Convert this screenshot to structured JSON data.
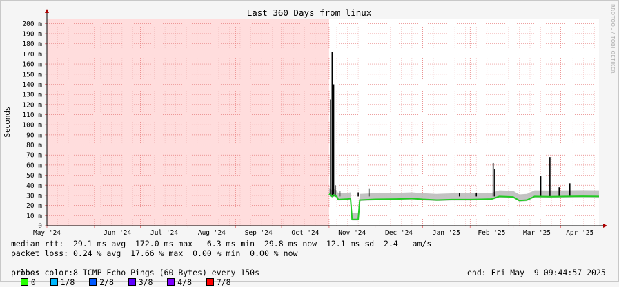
{
  "chart_data": {
    "type": "area",
    "title": "Last 360 Days from linux",
    "ylabel": "Seconds",
    "xlabel": "",
    "x_axis_type": "date",
    "x_range": [
      "2024-05-01",
      "2025-04-26"
    ],
    "ylim": [
      0,
      0.205
    ],
    "grid": true,
    "y_ticks": [
      {
        "value": 0,
        "label": "0"
      },
      {
        "value": 0.01,
        "label": "10 m"
      },
      {
        "value": 0.02,
        "label": "20 m"
      },
      {
        "value": 0.03,
        "label": "30 m"
      },
      {
        "value": 0.04,
        "label": "40 m"
      },
      {
        "value": 0.05,
        "label": "50 m"
      },
      {
        "value": 0.06,
        "label": "60 m"
      },
      {
        "value": 0.07,
        "label": "70 m"
      },
      {
        "value": 0.08,
        "label": "80 m"
      },
      {
        "value": 0.09,
        "label": "90 m"
      },
      {
        "value": 0.1,
        "label": "100 m"
      },
      {
        "value": 0.11,
        "label": "110 m"
      },
      {
        "value": 0.12,
        "label": "120 m"
      },
      {
        "value": 0.13,
        "label": "130 m"
      },
      {
        "value": 0.14,
        "label": "140 m"
      },
      {
        "value": 0.15,
        "label": "150 m"
      },
      {
        "value": 0.16,
        "label": "160 m"
      },
      {
        "value": 0.17,
        "label": "170 m"
      },
      {
        "value": 0.18,
        "label": "180 m"
      },
      {
        "value": 0.19,
        "label": "190 m"
      },
      {
        "value": 0.2,
        "label": "200 m"
      }
    ],
    "x_ticks": [
      {
        "date": "2024-05-01",
        "label": "May '24"
      },
      {
        "date": "2024-06-01",
        "label": "Jun '24"
      },
      {
        "date": "2024-07-01",
        "label": "Jul '24"
      },
      {
        "date": "2024-08-01",
        "label": "Aug '24"
      },
      {
        "date": "2024-09-01",
        "label": "Sep '24"
      },
      {
        "date": "2024-10-01",
        "label": "Oct '24"
      },
      {
        "date": "2024-11-01",
        "label": "Nov '24"
      },
      {
        "date": "2024-12-01",
        "label": "Dec '24"
      },
      {
        "date": "2025-01-01",
        "label": "Jan '25"
      },
      {
        "date": "2025-02-01",
        "label": "Feb '25"
      },
      {
        "date": "2025-03-01",
        "label": "Mar '25"
      },
      {
        "date": "2025-04-01",
        "label": "Apr '25"
      }
    ],
    "unknown_region": {
      "from": "2024-05-01",
      "to": "2024-11-01",
      "color": "#ffdddd"
    },
    "colors": {
      "background": "#f5f5f5",
      "plot_background": "#ffffff",
      "grid": "#e88080",
      "smoke": "#bdbdbd",
      "median_line": "#22cc22",
      "max_spike": "#000000",
      "axis": "#000000",
      "arrow": "#aa0000"
    },
    "series": [
      {
        "name": "median rtt",
        "points": [
          [
            "2024-11-01",
            0.0315
          ],
          [
            "2024-11-02",
            0.03
          ],
          [
            "2024-11-03",
            0.029
          ],
          [
            "2024-11-04",
            0.0305
          ],
          [
            "2024-11-05",
            0.0295
          ],
          [
            "2024-11-06",
            0.029
          ],
          [
            "2024-11-07",
            0.026
          ],
          [
            "2024-11-10",
            0.0262
          ],
          [
            "2024-11-13",
            0.0265
          ],
          [
            "2024-11-15",
            0.027
          ],
          [
            "2024-11-16",
            0.0063
          ],
          [
            "2024-11-20",
            0.0063
          ],
          [
            "2024-11-21",
            0.0255
          ],
          [
            "2024-12-01",
            0.0262
          ],
          [
            "2024-12-15",
            0.0265
          ],
          [
            "2024-12-25",
            0.027
          ],
          [
            "2025-01-01",
            0.0262
          ],
          [
            "2025-01-10",
            0.0255
          ],
          [
            "2025-01-20",
            0.026
          ],
          [
            "2025-02-01",
            0.026
          ],
          [
            "2025-02-15",
            0.0265
          ],
          [
            "2025-02-20",
            0.029
          ],
          [
            "2025-03-01",
            0.0285
          ],
          [
            "2025-03-05",
            0.025
          ],
          [
            "2025-03-10",
            0.0255
          ],
          [
            "2025-03-15",
            0.029
          ],
          [
            "2025-03-25",
            0.0288
          ],
          [
            "2025-04-05",
            0.029
          ],
          [
            "2025-04-15",
            0.0292
          ],
          [
            "2025-04-26",
            0.029
          ]
        ]
      },
      {
        "name": "max",
        "spikes": [
          [
            "2024-11-02",
            0.125
          ],
          [
            "2024-11-03",
            0.172
          ],
          [
            "2024-11-04",
            0.14
          ],
          [
            "2024-11-05",
            0.04
          ],
          [
            "2024-11-08",
            0.034
          ],
          [
            "2024-11-20",
            0.033
          ],
          [
            "2024-11-27",
            0.037
          ],
          [
            "2025-01-25",
            0.032
          ],
          [
            "2025-02-05",
            0.032
          ],
          [
            "2025-02-16",
            0.062
          ],
          [
            "2025-02-17",
            0.056
          ],
          [
            "2025-03-19",
            0.049
          ],
          [
            "2025-03-25",
            0.068
          ],
          [
            "2025-03-31",
            0.038
          ],
          [
            "2025-04-07",
            0.042
          ]
        ]
      }
    ]
  },
  "legend": {
    "rtt_line": "median rtt:  29.1 ms avg  172.0 ms max   6.3 ms min  29.8 ms now  12.1 ms sd  2.4   am/s",
    "loss_line": "packet loss: 0.24 % avg  17.66 % max  0.00 % min  0.00 % now",
    "loss_label": "loss color:",
    "loss_colors": [
      {
        "label": "0",
        "color": "#26ff00"
      },
      {
        "label": "1/8",
        "color": "#00b8ff"
      },
      {
        "label": "2/8",
        "color": "#0059ff"
      },
      {
        "label": "3/8",
        "color": "#5e00ff"
      },
      {
        "label": "4/8",
        "color": "#7e00ff"
      },
      {
        "label": "7/8",
        "color": "#ff0000"
      }
    ],
    "probe_line": "probe:       8 ICMP Echo Pings (60 Bytes) every 150s",
    "end_line": "end: Fri May  9 09:44:57 2025"
  },
  "watermark": "RRDTOOL / TOBI OETIKER"
}
